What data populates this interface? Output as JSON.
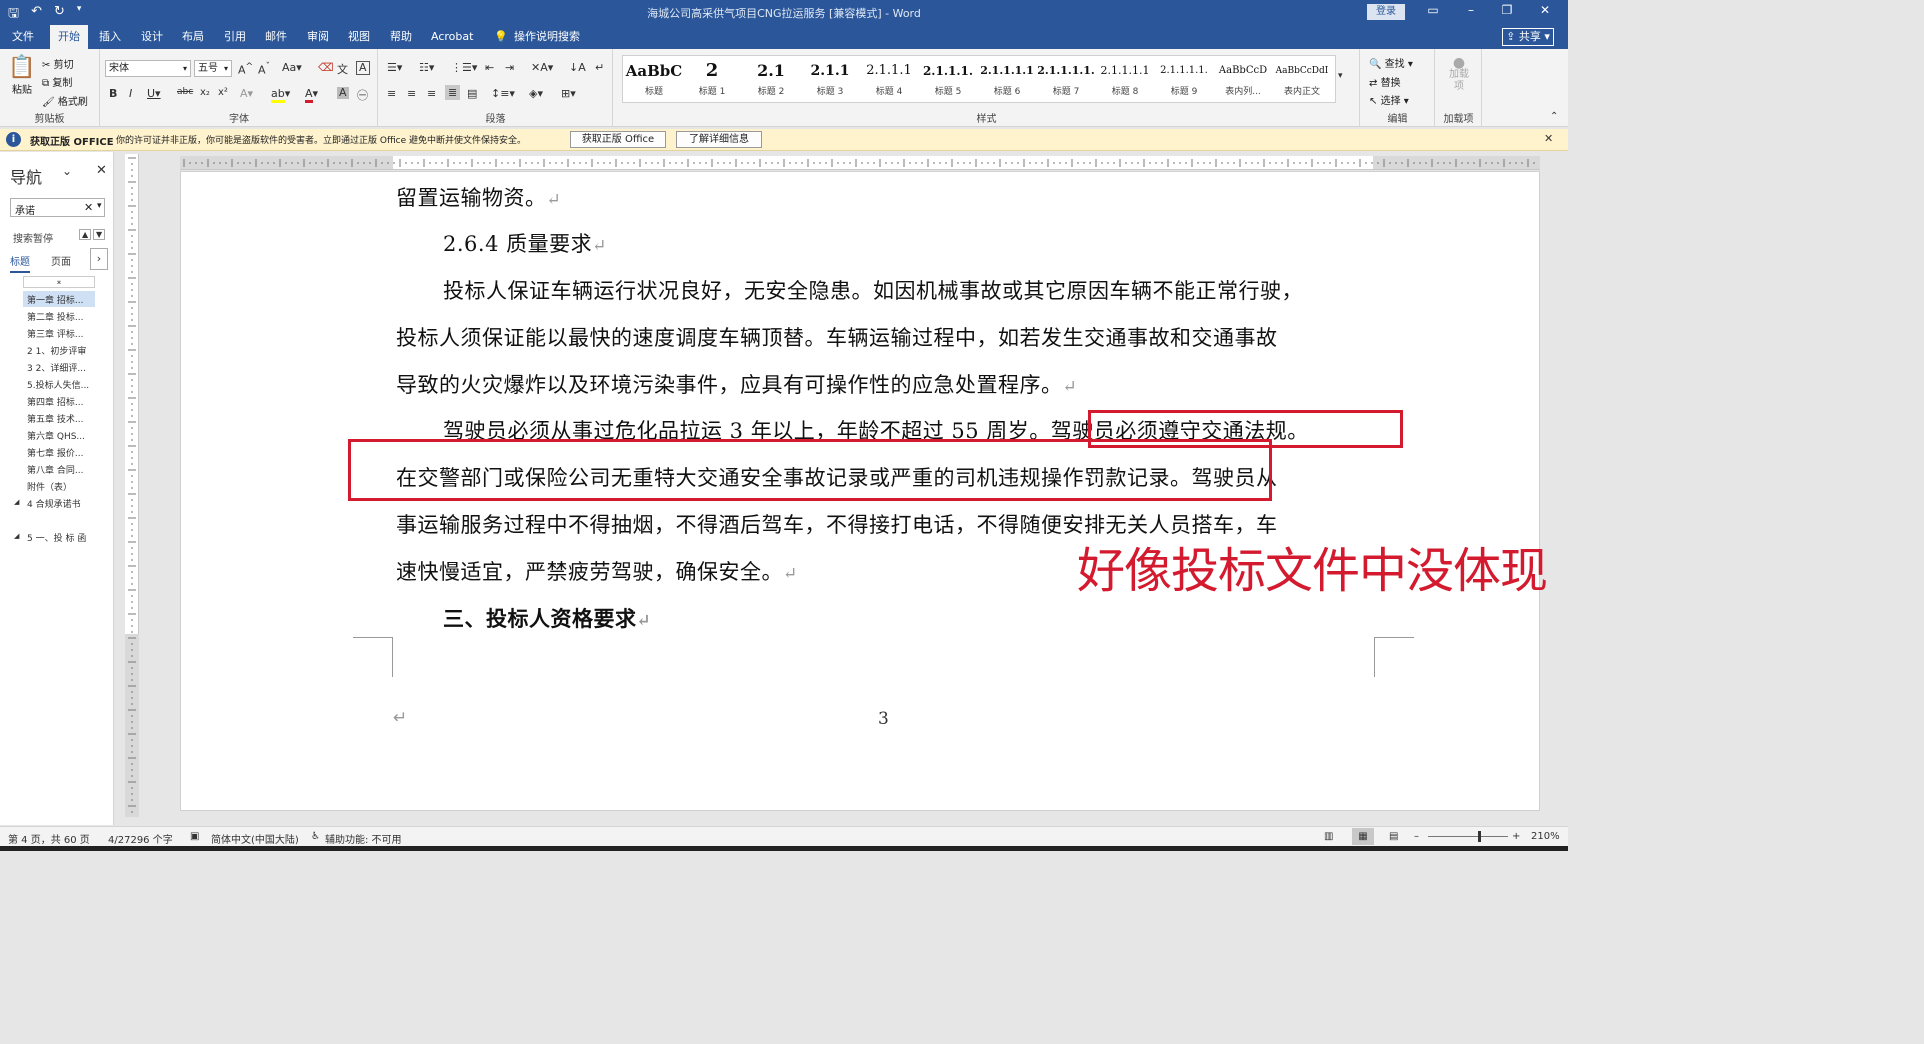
{
  "window": {
    "title": "海城公司高采供气项目CNG拉运服务 [兼容模式] - Word",
    "login": "登录"
  },
  "menu": {
    "tabs": [
      "文件",
      "开始",
      "插入",
      "设计",
      "布局",
      "引用",
      "邮件",
      "审阅",
      "视图",
      "帮助",
      "Acrobat",
      "操作说明搜索"
    ],
    "active": "开始",
    "share": "共享"
  },
  "ribbon": {
    "clipboard": {
      "paste": "粘贴",
      "cut": "剪切",
      "copy": "复制",
      "format_painter": "格式刷",
      "label": "剪贴板"
    },
    "font": {
      "font_name": "宋体",
      "font_size": "五号",
      "label": "字体"
    },
    "paragraph": {
      "label": "段落"
    },
    "styles": {
      "label": "样式",
      "items": [
        {
          "preview": "AaBbC",
          "name": "标题"
        },
        {
          "preview": "2",
          "name": "标题 1"
        },
        {
          "preview": "2.1",
          "name": "标题 2"
        },
        {
          "preview": "2.1.1",
          "name": "标题 3"
        },
        {
          "preview": "2.1.1.1",
          "name": "标题 4"
        },
        {
          "preview": "2.1.1.1.",
          "name": "标题 5"
        },
        {
          "preview": "2.1.1.1.1",
          "name": "标题 6"
        },
        {
          "preview": "2.1.1.1.1.",
          "name": "标题 7"
        },
        {
          "preview": "2.1.1.1.1",
          "name": "标题 8"
        },
        {
          "preview": "2.1.1.1.1.",
          "name": "标题 9"
        },
        {
          "preview": "AaBbCcD",
          "name": "表内列..."
        },
        {
          "preview": "AaBbCcDdI",
          "name": "表内正文"
        }
      ]
    },
    "editing": {
      "find": "查找",
      "replace": "替换",
      "select": "选择",
      "label": "编辑"
    },
    "addins": {
      "add": "加载项",
      "label": "加载项"
    }
  },
  "infobar": {
    "title": "获取正版 OFFICE",
    "message": "你的许可证并非正版，你可能是盗版软件的受害者。立即通过正版 Office 避免中断并使文件保持安全。",
    "btn_get": "获取正版 Office",
    "btn_learn": "了解详细信息"
  },
  "nav": {
    "title": "导航",
    "search_value": "承诺",
    "search_status": "搜索暂停",
    "tab_headings": "标题",
    "tab_pages": "页面",
    "items": [
      "第一章 招标...",
      "第二章 投标...",
      "第三章 评标...",
      "2 1、初步评审",
      "3 2、详细评...",
      "5.投标人失信...",
      "第四章 招标...",
      "第五章 技术...",
      "第六章 QHS...",
      "第七章 报价...",
      "第八章 合同...",
      "附件（表）",
      "4 合规承诺书",
      "5 一、投 标 函"
    ]
  },
  "document": {
    "lines": [
      "留置运输物资。",
      "2.6.4 质量要求",
      "投标人保证车辆运行状况良好，无安全隐患。如因机械事故或其它原因车辆不能正常行驶，",
      "投标人须保证能以最快的速度调度车辆顶替。车辆运输过程中，如若发生交通事故和交通事故",
      "导致的火灾爆炸以及环境污染事件，应具有可操作性的应急处置程序。",
      "驾驶员必须从事过危化品拉运 3 年以上，年龄不超过 55 周岁。驾驶员必须遵守交通法规。",
      "在交警部门或保险公司无重特大交通安全事故记录或严重的司机违规操作罚款记录。驾驶员从",
      "事运输服务过程中不得抽烟，不得酒后驾车，不得接打电话，不得随便安排无关人员搭车，车",
      "速快慢适宜，严禁疲劳驾驶，确保安全。",
      "三、投标人资格要求"
    ],
    "page_number": "3",
    "annotation": "好像投标文件中没体现"
  },
  "status": {
    "page": "第 4 页，共 60 页",
    "words": "4/27296 个字",
    "language": "简体中文(中国大陆)",
    "accessibility": "辅助功能: 不可用",
    "zoom": "210%"
  }
}
